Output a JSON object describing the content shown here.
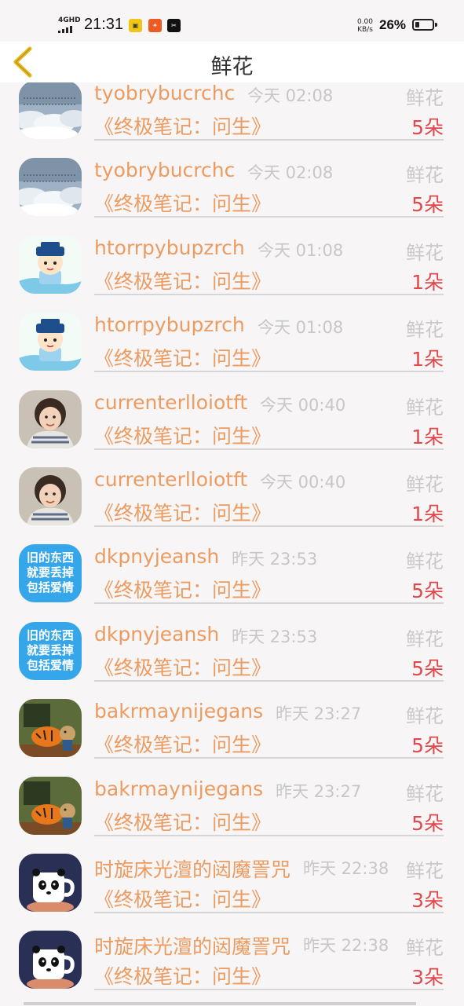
{
  "status_bar": {
    "network": "4GHD",
    "time": "21:31",
    "speed_value": "0.00",
    "speed_unit": "KB/s",
    "battery_text": "26%",
    "battery_level": 0.26,
    "app_icons": [
      "app-icon-1",
      "app-icon-2",
      "capcut-icon"
    ]
  },
  "header": {
    "title": "鲜花",
    "back_icon": "chevron-left-icon",
    "back_color": "#e8b81a"
  },
  "colors": {
    "username": "#ec9b61",
    "count": "#e0484b",
    "meta": "#c7c7c7"
  },
  "records": [
    {
      "user": "tyobrybucrchc",
      "time": "今天 02:08",
      "type": "鲜花",
      "book": "《终极笔记：问生》",
      "count": "5朵",
      "avatar": "clouds-avatar"
    },
    {
      "user": "tyobrybucrchc",
      "time": "今天 02:08",
      "type": "鲜花",
      "book": "《终极笔记：问生》",
      "count": "5朵",
      "avatar": "clouds-avatar"
    },
    {
      "user": "htorrpybupzrch",
      "time": "今天 01:08",
      "type": "鲜花",
      "book": "《终极笔记：问生》",
      "count": "1朵",
      "avatar": "cartoon-boy-avatar"
    },
    {
      "user": "htorrpybupzrch",
      "time": "今天 01:08",
      "type": "鲜花",
      "book": "《终极笔记：问生》",
      "count": "1朵",
      "avatar": "cartoon-boy-avatar"
    },
    {
      "user": "currenterlloiotft",
      "time": "今天 00:40",
      "type": "鲜花",
      "book": "《终极笔记：问生》",
      "count": "1朵",
      "avatar": "child-photo-avatar"
    },
    {
      "user": "currenterlloiotft",
      "time": "今天 00:40",
      "type": "鲜花",
      "book": "《终极笔记：问生》",
      "count": "1朵",
      "avatar": "child-photo-avatar"
    },
    {
      "user": "dkpnyjeansh",
      "time": "昨天 23:53",
      "type": "鲜花",
      "book": "《终极笔记：问生》",
      "count": "5朵",
      "avatar": "text-avatar",
      "avatar_text": [
        "旧的东西",
        "就要丢掉",
        "包括爱情"
      ]
    },
    {
      "user": "dkpnyjeansh",
      "time": "昨天 23:53",
      "type": "鲜花",
      "book": "《终极笔记：问生》",
      "count": "5朵",
      "avatar": "text-avatar",
      "avatar_text": [
        "旧的东西",
        "就要丢掉",
        "包括爱情"
      ]
    },
    {
      "user": "bakrmaynijegans",
      "time": "昨天 23:27",
      "type": "鲜花",
      "book": "《终极笔记：问生》",
      "count": "5朵",
      "avatar": "tiger-cartoon-avatar"
    },
    {
      "user": "bakrmaynijegans",
      "time": "昨天 23:27",
      "type": "鲜花",
      "book": "《终极笔记：问生》",
      "count": "5朵",
      "avatar": "tiger-cartoon-avatar"
    },
    {
      "user": "时旋床光澶的闼魔詈咒",
      "time": "昨天 22:38",
      "type": "鲜花",
      "book": "《终极笔记：问生》",
      "count": "3朵",
      "avatar": "panda-mug-avatar"
    },
    {
      "user": "时旋床光澶的闼魔詈咒",
      "time": "昨天 22:38",
      "type": "鲜花",
      "book": "《终极笔记：问生》",
      "count": "3朵",
      "avatar": "panda-mug-avatar"
    }
  ]
}
